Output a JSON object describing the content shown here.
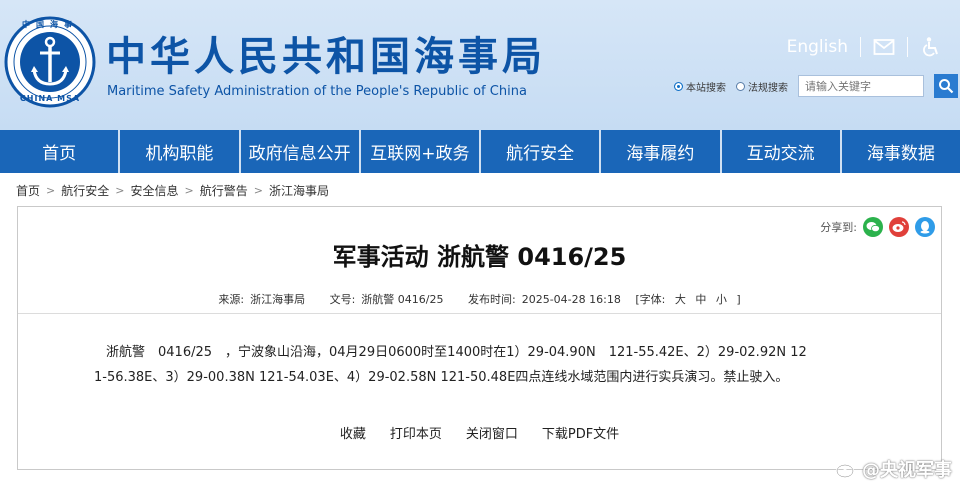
{
  "header": {
    "logo_top_text": "中国海事",
    "logo_bottom_text": "CHINA MSA",
    "title": "中华人民共和国海事局",
    "subtitle": "Maritime Safety Administration of the People's Republic of China",
    "english_link": "English",
    "icons": [
      "mail-icon",
      "accessibility-icon"
    ]
  },
  "search": {
    "option_site": "本站搜索",
    "option_law": "法规搜索",
    "placeholder": "请输入关键字"
  },
  "nav": {
    "items": [
      "首页",
      "机构职能",
      "政府信息公开",
      "互联网+政务",
      "航行安全",
      "海事履约",
      "互动交流",
      "海事数据"
    ]
  },
  "breadcrumb": {
    "items": [
      "首页",
      "航行安全",
      "安全信息",
      "航行警告",
      "浙江海事局"
    ],
    "separator": ">"
  },
  "share": {
    "label": "分享到:"
  },
  "article": {
    "title": "军事活动 浙航警 0416/25",
    "source_label": "来源:",
    "source_value": "浙江海事局",
    "docno_label": "文号:",
    "docno_value": "浙航警 0416/25",
    "time_label": "发布时间:",
    "time_value": "2025-04-28 16:18",
    "font_label": "[字体:",
    "font_large": "大",
    "font_medium": "中",
    "font_small": "小",
    "font_close": "]",
    "body_line1": "浙航警　0416/25　，宁波象山沿海，04月29日0600时至1400时在1）29-04.90N　121-55.42E、2）29-02.92N 12",
    "body_line2": "1-56.38E、3）29-00.38N 121-54.03E、4）29-02.58N 121-50.48E四点连线水域范围内进行实兵演习。禁止驶入。"
  },
  "actions": [
    "收藏",
    "打印本页",
    "关闭窗口",
    "下载PDF文件"
  ],
  "watermark": {
    "text": "@央视军事"
  },
  "colors": {
    "brand_blue": "#0d54a6",
    "nav_blue": "#1a66b8",
    "header_bg": "#d6e6f7",
    "wechat_green": "#2bb24c",
    "weibo_red": "#e0403a",
    "qq_blue": "#2f9ce8"
  }
}
